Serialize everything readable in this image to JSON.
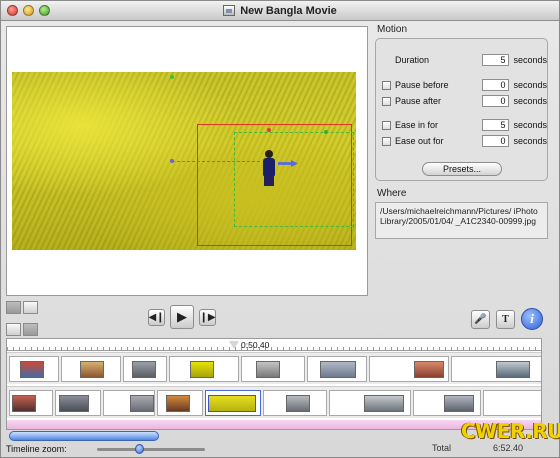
{
  "window": {
    "title": "New Bangla Movie"
  },
  "motion": {
    "title": "Motion",
    "duration": {
      "label": "Duration",
      "value": "5",
      "unit": "seconds"
    },
    "pause_before": {
      "label": "Pause before",
      "value": "0",
      "unit": "seconds",
      "checked": false
    },
    "pause_after": {
      "label": "Pause after",
      "value": "0",
      "unit": "seconds",
      "checked": false
    },
    "ease_in": {
      "label": "Ease in for",
      "value": "5",
      "unit": "seconds",
      "checked": false
    },
    "ease_out": {
      "label": "Ease out for",
      "value": "0",
      "unit": "seconds",
      "checked": false
    },
    "presets_label": "Presets..."
  },
  "where": {
    "title": "Where",
    "path": "/Users/michaelreichmann/Pictures/ iPhoto Library/2005/01/04/ _A1C2340-00999.jpg"
  },
  "timeline": {
    "playhead_time": "0:50.40"
  },
  "footer": {
    "zoom_label": "Timeline zoom:",
    "total_label": "Total",
    "total_value": "6:52.40"
  },
  "watermark": {
    "text": "CWER.RU"
  },
  "colors": {
    "crop_red": "#e0352b",
    "crop_green": "#3bbf3b",
    "info_blue": "#2d5fd6"
  },
  "icons": {
    "rewind": "skip-back-icon",
    "play": "play-icon",
    "forward": "skip-forward-icon",
    "voiceover": "microphone-icon",
    "title": "text-icon",
    "info": "info-icon"
  }
}
